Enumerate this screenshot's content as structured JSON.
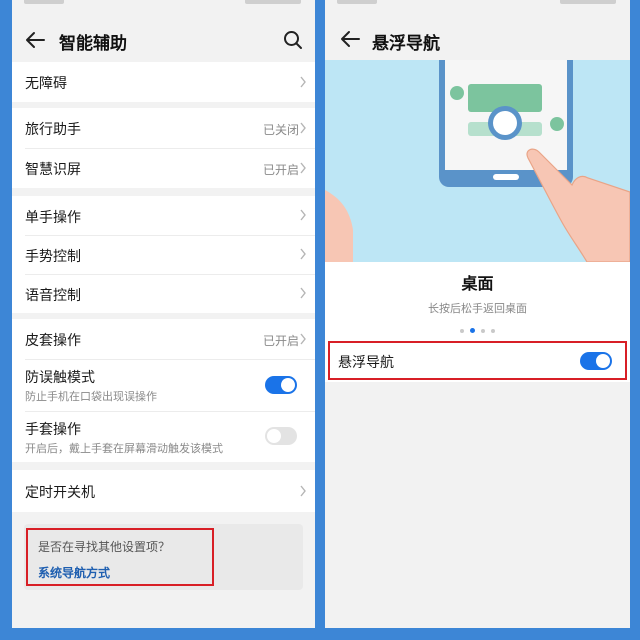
{
  "left": {
    "title": "智能辅助",
    "groups": [
      {
        "rows": [
          {
            "label": "无障碍"
          }
        ]
      },
      {
        "rows": [
          {
            "label": "旅行助手",
            "value": "已关闭"
          },
          {
            "label": "智慧识屏",
            "value": "已开启"
          }
        ]
      },
      {
        "rows": [
          {
            "label": "单手操作"
          },
          {
            "label": "手势控制"
          },
          {
            "label": "语音控制"
          }
        ]
      },
      {
        "rows": [
          {
            "label": "皮套操作",
            "value": "已开启"
          },
          {
            "label": "防误触模式",
            "sub": "防止手机在口袋出现误操作",
            "toggle": true
          },
          {
            "label": "手套操作",
            "sub": "开启后，戴上手套在屏幕滑动触发该模式",
            "toggle": false
          }
        ]
      },
      {
        "rows": [
          {
            "label": "定时开关机"
          }
        ]
      }
    ],
    "suggest": {
      "question": "是否在寻找其他设置项？",
      "link": "系统导航方式"
    }
  },
  "right": {
    "title": "悬浮导航",
    "slide_title": "桌面",
    "slide_sub": "长按后松手返回桌面",
    "slides_total": 4,
    "slide_active": 2,
    "row_label": "悬浮导航",
    "row_toggle": true
  },
  "colors": {
    "frame": "#3d86d6",
    "accent": "#1a73e8",
    "highlight_border": "#d81f26",
    "illustration_bg": "#bde6f5"
  }
}
